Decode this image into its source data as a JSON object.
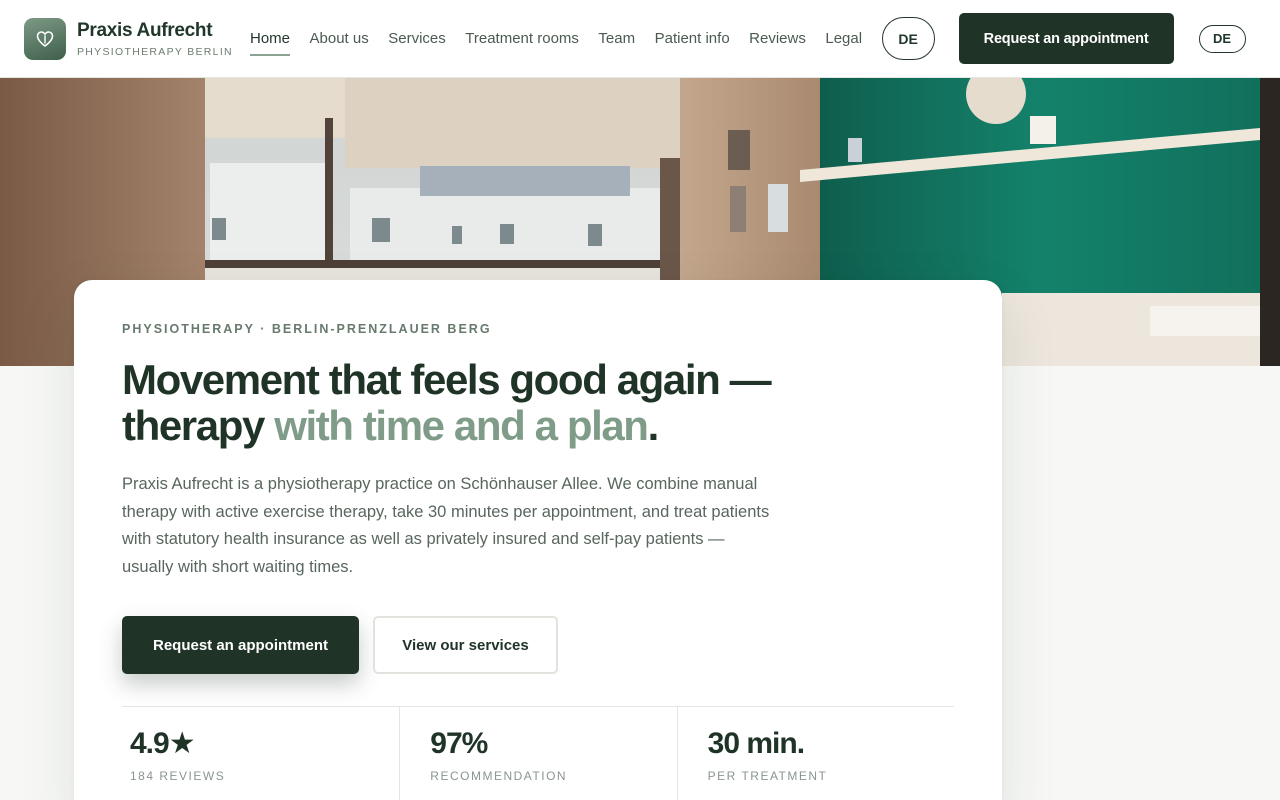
{
  "brand": {
    "name": "Praxis Aufrecht",
    "subtitle": "PHYSIOTHERAPY BERLIN"
  },
  "nav": {
    "items": [
      "Home",
      "About us",
      "Services",
      "Treatment rooms",
      "Team",
      "Patient info",
      "Reviews",
      "Legal"
    ],
    "active": "Home",
    "lang_circle": "DE",
    "cta": "Request an appointment",
    "lang_pill": "DE"
  },
  "hero": {
    "eyebrow": "PHYSIOTHERAPY · BERLIN-PRENZLAUER BERG",
    "headline_main": "Movement that feels good again — therapy ",
    "headline_accent": "with time and a plan",
    "headline_end": ".",
    "lead": "Praxis Aufrecht is a physiotherapy practice on Schönhauser Allee. We combine manual therapy with active exercise therapy, take 30 minutes per appointment, and treat patients with statutory health insurance as well as privately insured and self-pay patients — usually with short waiting times.",
    "primary_button": "Request an appointment",
    "secondary_button": "View our services"
  },
  "stats": [
    {
      "value": "4.9★",
      "label": "184 REVIEWS"
    },
    {
      "value": "97%",
      "label": "RECOMMENDATION"
    },
    {
      "value": "30 min.",
      "label": "PER TREATMENT"
    }
  ],
  "colors": {
    "primary": "#1f3327",
    "accent": "#7f9c88",
    "text_muted": "#58665d",
    "wall_teal": "#14826b"
  },
  "icons": {
    "logo": "heart-leaf-icon"
  }
}
